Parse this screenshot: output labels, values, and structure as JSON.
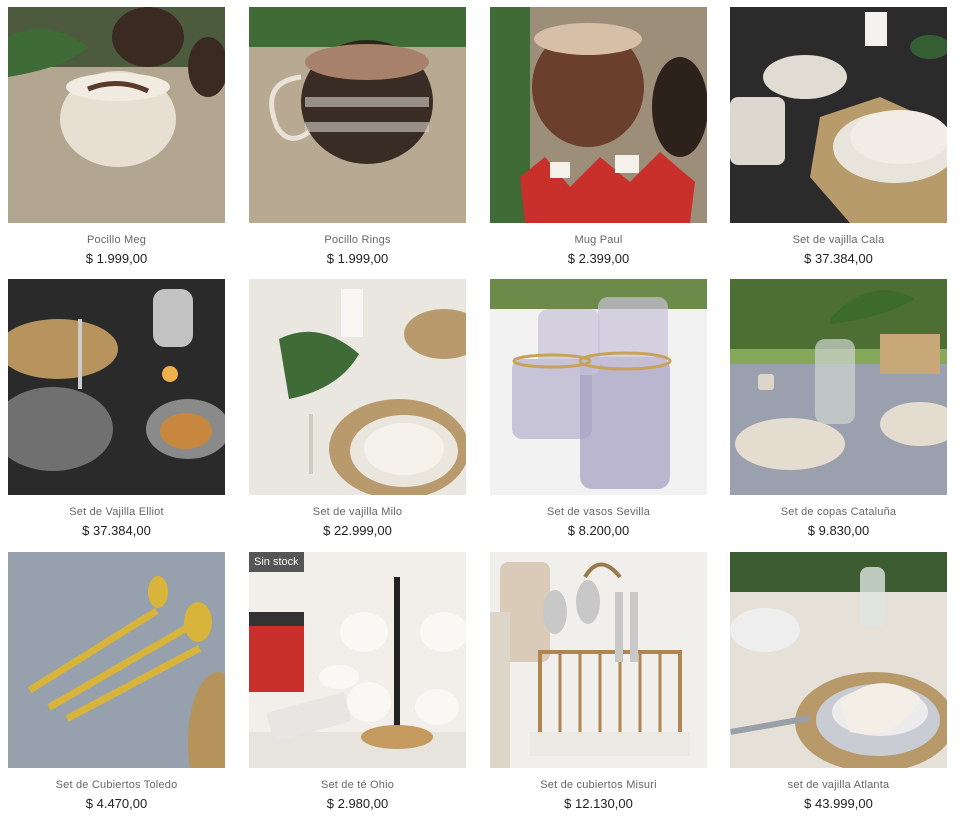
{
  "products": [
    {
      "name": "Pocillo Meg",
      "price": "$ 1.999,00"
    },
    {
      "name": "Pocillo Rings",
      "price": "$ 1.999,00"
    },
    {
      "name": "Mug Paul",
      "price": "$ 2.399,00"
    },
    {
      "name": "Set de vajilla Cala",
      "price": "$ 37.384,00"
    },
    {
      "name": "Set de Vajilla Elliot",
      "price": "$ 37.384,00"
    },
    {
      "name": "Set de vajilla Milo",
      "price": "$ 22.999,00"
    },
    {
      "name": "Set de vasos Sevilla",
      "price": "$ 8.200,00"
    },
    {
      "name": "Set de copas Cataluña",
      "price": "$ 9.830,00"
    },
    {
      "name": "Set de Cubiertos Toledo",
      "price": "$ 4.470,00"
    },
    {
      "name": "Set de té Ohio",
      "price": "$ 2.980,00",
      "badge": "Sin stock"
    },
    {
      "name": "Set de cubiertos Misuri",
      "price": "$ 12.130,00"
    },
    {
      "name": "set de vajilla Atlanta",
      "price": "$ 43.999,00"
    }
  ]
}
